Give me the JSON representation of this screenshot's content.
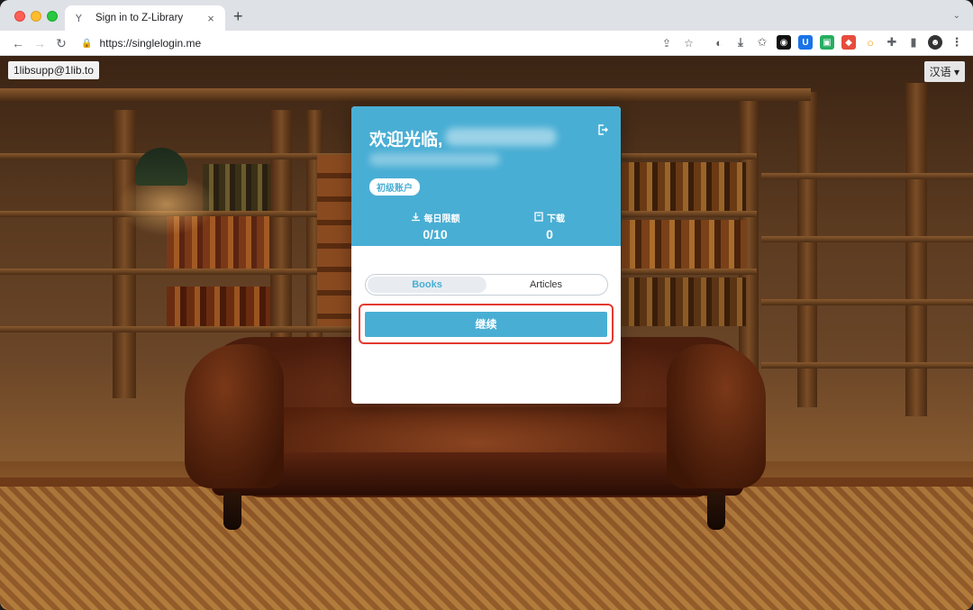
{
  "browser": {
    "tab_title": "Sign in to Z-Library",
    "tab_favicon": "Y",
    "new_tab": "+",
    "url": "https://singlelogin.me"
  },
  "page": {
    "account_email": "1libsupp@1lib.to",
    "language": "汉语 ▾"
  },
  "card": {
    "greeting": "欢迎光临,",
    "account_badge": "初级账户",
    "stats": [
      {
        "label": "每日限额",
        "value": "0/10",
        "icon": "download-icon"
      },
      {
        "label": "下载",
        "value": "0",
        "icon": "book-icon"
      }
    ],
    "tabs": [
      {
        "label": "Books",
        "active": true
      },
      {
        "label": "Articles",
        "active": false
      }
    ],
    "continue_label": "继续"
  },
  "colors": {
    "accent": "#49aed4",
    "highlight": "#e23a2f"
  }
}
